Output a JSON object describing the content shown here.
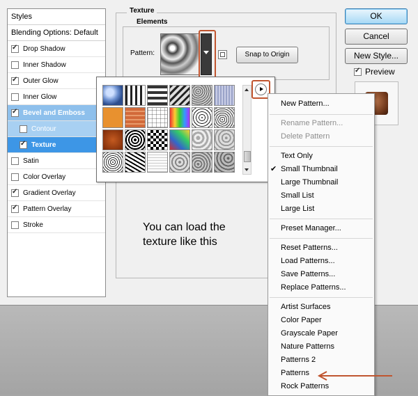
{
  "styles_panel": {
    "header": "Styles",
    "blending": "Blending Options: Default",
    "items": [
      {
        "label": "Drop Shadow",
        "checked": true
      },
      {
        "label": "Inner Shadow",
        "checked": false
      },
      {
        "label": "Outer Glow",
        "checked": true
      },
      {
        "label": "Inner Glow",
        "checked": false
      },
      {
        "label": "Bevel and Emboss",
        "checked": true
      },
      {
        "label": "Contour",
        "checked": false
      },
      {
        "label": "Texture",
        "checked": true
      },
      {
        "label": "Satin",
        "checked": false
      },
      {
        "label": "Color Overlay",
        "checked": false
      },
      {
        "label": "Gradient Overlay",
        "checked": true
      },
      {
        "label": "Pattern Overlay",
        "checked": true
      },
      {
        "label": "Stroke",
        "checked": false
      }
    ]
  },
  "texture": {
    "group_title": "Texture",
    "elements_title": "Elements",
    "pattern_label": "Pattern:",
    "snap_label": "Snap to Origin"
  },
  "buttons": {
    "ok": "OK",
    "cancel": "Cancel",
    "new_style": "New Style...",
    "preview": "Preview"
  },
  "annotation": "You can load the texture like this",
  "menu": {
    "new_pattern": "New Pattern...",
    "rename": "Rename Pattern...",
    "delete": "Delete Pattern",
    "text_only": "Text Only",
    "small_thumb": "Small Thumbnail",
    "large_thumb": "Large Thumbnail",
    "small_list": "Small List",
    "large_list": "Large List",
    "preset_manager": "Preset Manager...",
    "reset": "Reset Patterns...",
    "load": "Load Patterns...",
    "save": "Save Patterns...",
    "replace": "Replace Patterns...",
    "artist": "Artist Surfaces",
    "color_paper": "Color Paper",
    "grayscale_paper": "Grayscale Paper",
    "nature": "Nature Patterns",
    "patterns2": "Patterns 2",
    "patterns": "Patterns",
    "rock": "Rock Patterns"
  },
  "colors": {
    "annotation_red": "#c0552f",
    "selection_blue": "#3d96e6"
  }
}
